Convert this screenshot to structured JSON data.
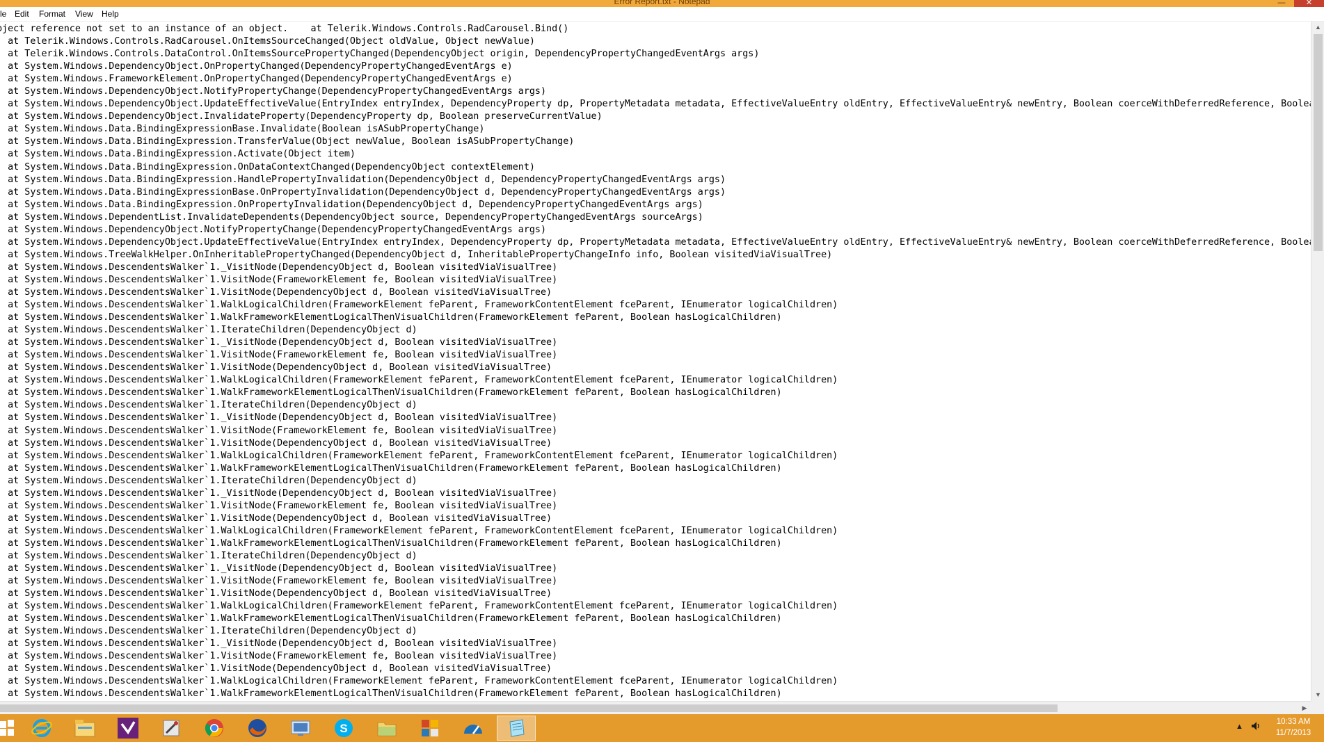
{
  "window": {
    "title": "Error Report.txt - Notepad",
    "minimize_glyph": "—",
    "close_glyph": "✕"
  },
  "menu": {
    "items": [
      "le",
      "Edit",
      "Format",
      "View",
      "Help"
    ]
  },
  "editor": {
    "lines": [
      "bject reference not set to an instance of an object.    at Telerik.Windows.Controls.RadCarousel.Bind()",
      "  at Telerik.Windows.Controls.RadCarousel.OnItemsSourceChanged(Object oldValue, Object newValue)",
      "  at Telerik.Windows.Controls.DataControl.OnItemsSourcePropertyChanged(DependencyObject origin, DependencyPropertyChangedEventArgs args)",
      "  at System.Windows.DependencyObject.OnPropertyChanged(DependencyPropertyChangedEventArgs e)",
      "  at System.Windows.FrameworkElement.OnPropertyChanged(DependencyPropertyChangedEventArgs e)",
      "  at System.Windows.DependencyObject.NotifyPropertyChange(DependencyPropertyChangedEventArgs args)",
      "  at System.Windows.DependencyObject.UpdateEffectiveValue(EntryIndex entryIndex, DependencyProperty dp, PropertyMetadata metadata, EffectiveValueEntry oldEntry, EffectiveValueEntry& newEntry, Boolean coerceWithDeferredReference, Boolea",
      "  at System.Windows.DependencyObject.InvalidateProperty(DependencyProperty dp, Boolean preserveCurrentValue)",
      "  at System.Windows.Data.BindingExpressionBase.Invalidate(Boolean isASubPropertyChange)",
      "  at System.Windows.Data.BindingExpression.TransferValue(Object newValue, Boolean isASubPropertyChange)",
      "  at System.Windows.Data.BindingExpression.Activate(Object item)",
      "  at System.Windows.Data.BindingExpression.OnDataContextChanged(DependencyObject contextElement)",
      "  at System.Windows.Data.BindingExpression.HandlePropertyInvalidation(DependencyObject d, DependencyPropertyChangedEventArgs args)",
      "  at System.Windows.Data.BindingExpressionBase.OnPropertyInvalidation(DependencyObject d, DependencyPropertyChangedEventArgs args)",
      "  at System.Windows.Data.BindingExpression.OnPropertyInvalidation(DependencyObject d, DependencyPropertyChangedEventArgs args)",
      "  at System.Windows.DependentList.InvalidateDependents(DependencyObject source, DependencyPropertyChangedEventArgs sourceArgs)",
      "  at System.Windows.DependencyObject.NotifyPropertyChange(DependencyPropertyChangedEventArgs args)",
      "  at System.Windows.DependencyObject.UpdateEffectiveValue(EntryIndex entryIndex, DependencyProperty dp, PropertyMetadata metadata, EffectiveValueEntry oldEntry, EffectiveValueEntry& newEntry, Boolean coerceWithDeferredReference, Boolea",
      "  at System.Windows.TreeWalkHelper.OnInheritablePropertyChanged(DependencyObject d, InheritablePropertyChangeInfo info, Boolean visitedViaVisualTree)",
      "  at System.Windows.DescendentsWalker`1._VisitNode(DependencyObject d, Boolean visitedViaVisualTree)",
      "  at System.Windows.DescendentsWalker`1.VisitNode(FrameworkElement fe, Boolean visitedViaVisualTree)",
      "  at System.Windows.DescendentsWalker`1.VisitNode(DependencyObject d, Boolean visitedViaVisualTree)",
      "  at System.Windows.DescendentsWalker`1.WalkLogicalChildren(FrameworkElement feParent, FrameworkContentElement fceParent, IEnumerator logicalChildren)",
      "  at System.Windows.DescendentsWalker`1.WalkFrameworkElementLogicalThenVisualChildren(FrameworkElement feParent, Boolean hasLogicalChildren)",
      "  at System.Windows.DescendentsWalker`1.IterateChildren(DependencyObject d)",
      "  at System.Windows.DescendentsWalker`1._VisitNode(DependencyObject d, Boolean visitedViaVisualTree)",
      "  at System.Windows.DescendentsWalker`1.VisitNode(FrameworkElement fe, Boolean visitedViaVisualTree)",
      "  at System.Windows.DescendentsWalker`1.VisitNode(DependencyObject d, Boolean visitedViaVisualTree)",
      "  at System.Windows.DescendentsWalker`1.WalkLogicalChildren(FrameworkElement feParent, FrameworkContentElement fceParent, IEnumerator logicalChildren)",
      "  at System.Windows.DescendentsWalker`1.WalkFrameworkElementLogicalThenVisualChildren(FrameworkElement feParent, Boolean hasLogicalChildren)",
      "  at System.Windows.DescendentsWalker`1.IterateChildren(DependencyObject d)",
      "  at System.Windows.DescendentsWalker`1._VisitNode(DependencyObject d, Boolean visitedViaVisualTree)",
      "  at System.Windows.DescendentsWalker`1.VisitNode(FrameworkElement fe, Boolean visitedViaVisualTree)",
      "  at System.Windows.DescendentsWalker`1.VisitNode(DependencyObject d, Boolean visitedViaVisualTree)",
      "  at System.Windows.DescendentsWalker`1.WalkLogicalChildren(FrameworkElement feParent, FrameworkContentElement fceParent, IEnumerator logicalChildren)",
      "  at System.Windows.DescendentsWalker`1.WalkFrameworkElementLogicalThenVisualChildren(FrameworkElement feParent, Boolean hasLogicalChildren)",
      "  at System.Windows.DescendentsWalker`1.IterateChildren(DependencyObject d)",
      "  at System.Windows.DescendentsWalker`1._VisitNode(DependencyObject d, Boolean visitedViaVisualTree)",
      "  at System.Windows.DescendentsWalker`1.VisitNode(FrameworkElement fe, Boolean visitedViaVisualTree)",
      "  at System.Windows.DescendentsWalker`1.VisitNode(DependencyObject d, Boolean visitedViaVisualTree)",
      "  at System.Windows.DescendentsWalker`1.WalkLogicalChildren(FrameworkElement feParent, FrameworkContentElement fceParent, IEnumerator logicalChildren)",
      "  at System.Windows.DescendentsWalker`1.WalkFrameworkElementLogicalThenVisualChildren(FrameworkElement feParent, Boolean hasLogicalChildren)",
      "  at System.Windows.DescendentsWalker`1.IterateChildren(DependencyObject d)",
      "  at System.Windows.DescendentsWalker`1._VisitNode(DependencyObject d, Boolean visitedViaVisualTree)",
      "  at System.Windows.DescendentsWalker`1.VisitNode(FrameworkElement fe, Boolean visitedViaVisualTree)",
      "  at System.Windows.DescendentsWalker`1.VisitNode(DependencyObject d, Boolean visitedViaVisualTree)",
      "  at System.Windows.DescendentsWalker`1.WalkLogicalChildren(FrameworkElement feParent, FrameworkContentElement fceParent, IEnumerator logicalChildren)",
      "  at System.Windows.DescendentsWalker`1.WalkFrameworkElementLogicalThenVisualChildren(FrameworkElement feParent, Boolean hasLogicalChildren)",
      "  at System.Windows.DescendentsWalker`1.IterateChildren(DependencyObject d)",
      "  at System.Windows.DescendentsWalker`1._VisitNode(DependencyObject d, Boolean visitedViaVisualTree)",
      "  at System.Windows.DescendentsWalker`1.VisitNode(FrameworkElement fe, Boolean visitedViaVisualTree)",
      "  at System.Windows.DescendentsWalker`1.VisitNode(DependencyObject d, Boolean visitedViaVisualTree)",
      "  at System.Windows.DescendentsWalker`1.WalkLogicalChildren(FrameworkElement feParent, FrameworkContentElement fceParent, IEnumerator logicalChildren)",
      "  at System.Windows.DescendentsWalker`1.WalkFrameworkElementLogicalThenVisualChildren(FrameworkElement feParent, Boolean hasLogicalChildren)"
    ]
  },
  "taskbar": {
    "apps": [
      {
        "name": "internet-explorer-icon",
        "active": false
      },
      {
        "name": "file-explorer-icon",
        "active": false
      },
      {
        "name": "visual-studio-icon",
        "active": false
      },
      {
        "name": "tools-icon",
        "active": false
      },
      {
        "name": "chrome-icon",
        "active": false
      },
      {
        "name": "firefox-icon",
        "active": false
      },
      {
        "name": "remote-desktop-icon",
        "active": false
      },
      {
        "name": "skype-icon",
        "active": false
      },
      {
        "name": "folder-icon",
        "active": false
      },
      {
        "name": "office-icon",
        "active": false
      },
      {
        "name": "dashboard-icon",
        "active": false
      },
      {
        "name": "notepad-icon",
        "active": true
      }
    ],
    "clock_time": "10:33 AM",
    "clock_date": "11/7/2013"
  },
  "colors": {
    "taskbar": "#e59a2c",
    "titlebar": "#f2a93b",
    "close_button": "#c7402d"
  }
}
